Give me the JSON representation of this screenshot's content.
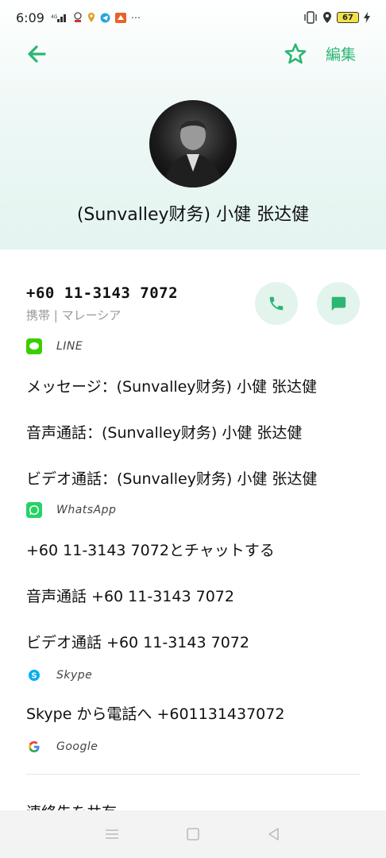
{
  "status_bar": {
    "time": "6:09",
    "battery": "67",
    "left_icons": [
      "signal-icon",
      "notification-icon",
      "location-icon",
      "telegram-icon",
      "app-icon",
      "more-icon"
    ]
  },
  "toolbar": {
    "back": "back-arrow-icon",
    "favorite": "star-icon",
    "edit_label": "編集"
  },
  "contact": {
    "name": "(Sunvalley财务) 小健 张达健"
  },
  "phone": {
    "number": "+60 11-3143 7072",
    "type": "携帯 | マレーシア"
  },
  "apps": [
    {
      "name": "LINE",
      "color": "#3ACE01",
      "actions": [
        "メッセージ：(Sunvalley财务) 小健 张达健",
        "音声通話：(Sunvalley财务) 小健 张达健",
        "ビデオ通話：(Sunvalley财务) 小健 张达健"
      ]
    },
    {
      "name": "WhatsApp",
      "color": "#25D366",
      "actions": [
        "+60 11-3143 7072とチャットする",
        "音声通話 +60 11-3143 7072",
        "ビデオ通話 +60 11-3143 7072"
      ]
    },
    {
      "name": "Skype",
      "color": "#00AFF0",
      "actions": [
        "Skype から電話へ +601131437072"
      ]
    },
    {
      "name": "Google",
      "color": "#4285F4",
      "actions": []
    }
  ],
  "share": {
    "label": "連絡先を共有"
  },
  "colors": {
    "accent": "#2bb673",
    "accent_bg": "#e2f4ec"
  }
}
